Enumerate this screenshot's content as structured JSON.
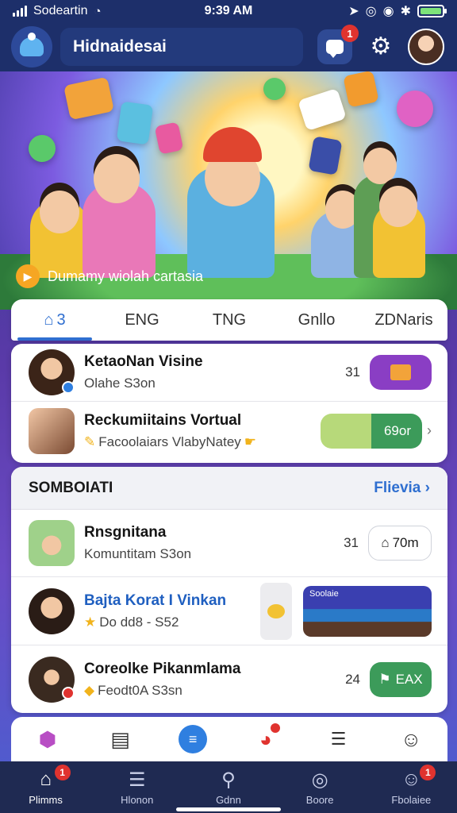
{
  "status_bar": {
    "carrier": "Sodeartin",
    "time": "9:39 AM"
  },
  "header": {
    "app_title": "Hidnaidesai",
    "message_badge": "1"
  },
  "hero": {
    "caption": "Dumamy wiolah cartasia"
  },
  "tabs": [
    {
      "label": "3",
      "icon": "home-icon",
      "active": true
    },
    {
      "label": "ENG"
    },
    {
      "label": "TNG"
    },
    {
      "label": "Gnllo"
    },
    {
      "label": "ZDNaris"
    }
  ],
  "top_list": [
    {
      "title": "KetaoNan Visine",
      "subtitle": "Olahe S3on",
      "count": "31",
      "action": "tv-thumbnail"
    },
    {
      "title": "Reckumiitains Vortual",
      "subtitle": "Facoolaiars VlabyNatey",
      "action_label": "69or"
    }
  ],
  "section": {
    "title": "SOMBOIATI",
    "link": "Flievia"
  },
  "section_list": [
    {
      "title": "Rnsgnitana",
      "subtitle": "Komuntitam S3on",
      "count": "31",
      "action_label": "70m"
    },
    {
      "title": "Bajta Korat I Vinkan",
      "subtitle": "Do dd8 - S52",
      "thumb_label": "Soolaie"
    },
    {
      "title": "Coreolke Pikanmlama",
      "subtitle": "Feodt0A S3sn",
      "count": "24",
      "action_label": "EAX"
    }
  ],
  "dock_icons": [
    "hexagon-app-icon",
    "bag-icon",
    "chat-app-icon",
    "notify-app-icon",
    "code-icon",
    "face-icon"
  ],
  "bottom_nav": [
    {
      "label": "Plimms",
      "icon": "home-icon",
      "badge": "1"
    },
    {
      "label": "Hlonon",
      "icon": "list-icon"
    },
    {
      "label": "Gdnn",
      "icon": "search-icon"
    },
    {
      "label": "Boore",
      "icon": "globe-icon"
    },
    {
      "label": "Fbolaiee",
      "icon": "profile-icon",
      "badge": "1"
    }
  ],
  "colors": {
    "accent": "#2f6fd0",
    "header_bg": "#1d2f6a",
    "badge": "#e0332f",
    "green_action": "#3c9b5a"
  }
}
